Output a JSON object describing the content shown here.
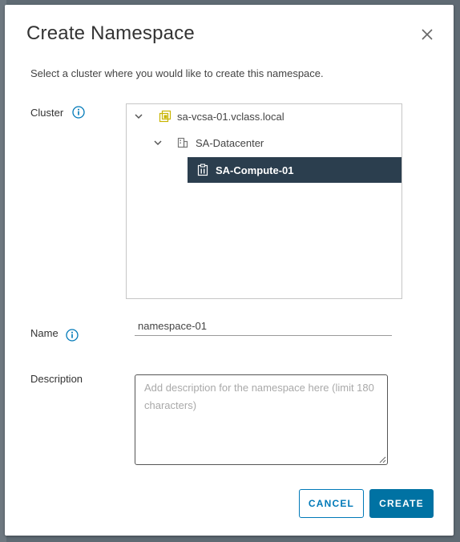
{
  "dialog": {
    "title": "Create Namespace",
    "subtitle": "Select a cluster where you would like to create this namespace."
  },
  "cluster": {
    "label": "Cluster",
    "tree": {
      "vcenter": {
        "label": "sa-vcsa-01.vclass.local",
        "icon": "vcenter-icon",
        "expanded": true
      },
      "datacenter": {
        "label": "SA-Datacenter",
        "icon": "datacenter-icon",
        "expanded": true
      },
      "compute": {
        "label": "SA-Compute-01",
        "icon": "cluster-icon",
        "selected": true
      }
    }
  },
  "name": {
    "label": "Name",
    "value": "namespace-01"
  },
  "description": {
    "label": "Description",
    "placeholder": "Add description for the namespace here (limit 180 characters)",
    "value": ""
  },
  "buttons": {
    "cancel": "CANCEL",
    "create": "CREATE"
  },
  "colors": {
    "primary": "#0072a3",
    "selected_row": "#2b3e4e",
    "info_icon": "#0079b8"
  }
}
